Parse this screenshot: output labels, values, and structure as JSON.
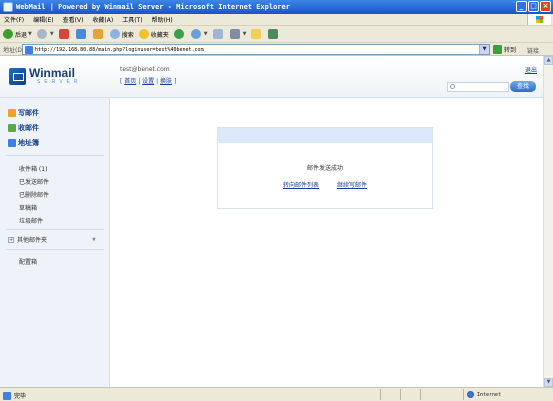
{
  "window": {
    "title": "WebMail | Powered by Winmail Server - Microsoft Internet Explorer",
    "controls": [
      "_",
      "□",
      "×"
    ]
  },
  "menubar": [
    "文件(F)",
    "编辑(E)",
    "查看(V)",
    "收藏(A)",
    "工具(T)",
    "帮助(H)"
  ],
  "toolbar": {
    "back": "后退",
    "search": "搜索",
    "favorites": "收藏夹"
  },
  "addressbar": {
    "label": "地址(D)",
    "url": "http://192.168.80.88/main.php?loginuser=test%40benet.com",
    "go": "转到",
    "links": "链接"
  },
  "header": {
    "brand": "Winmail",
    "brand_sub": "SERVER",
    "user": "test@benet.com",
    "links": [
      "首页",
      "设置",
      "换肤"
    ],
    "separator": "|",
    "logout": "退出",
    "search_button": "查找"
  },
  "sidebar": {
    "actions": [
      {
        "label": "写邮件",
        "icon": "compose-icon",
        "color": "#f0a030"
      },
      {
        "label": "收邮件",
        "icon": "inbox-icon",
        "color": "#5aa84a"
      },
      {
        "label": "地址簿",
        "icon": "addressbook-icon",
        "color": "#3f7ee3"
      }
    ],
    "folders": [
      "收件箱 (1)",
      "已发送邮件",
      "已删除邮件",
      "草稿箱",
      "垃圾邮件"
    ],
    "other_folders": "其他邮件夹",
    "config": "配置箱"
  },
  "result": {
    "message": "邮件发送成功",
    "actions": [
      "转向邮件列表",
      "继续写邮件"
    ]
  },
  "statusbar": {
    "status": "完毕",
    "zone": "Internet"
  }
}
